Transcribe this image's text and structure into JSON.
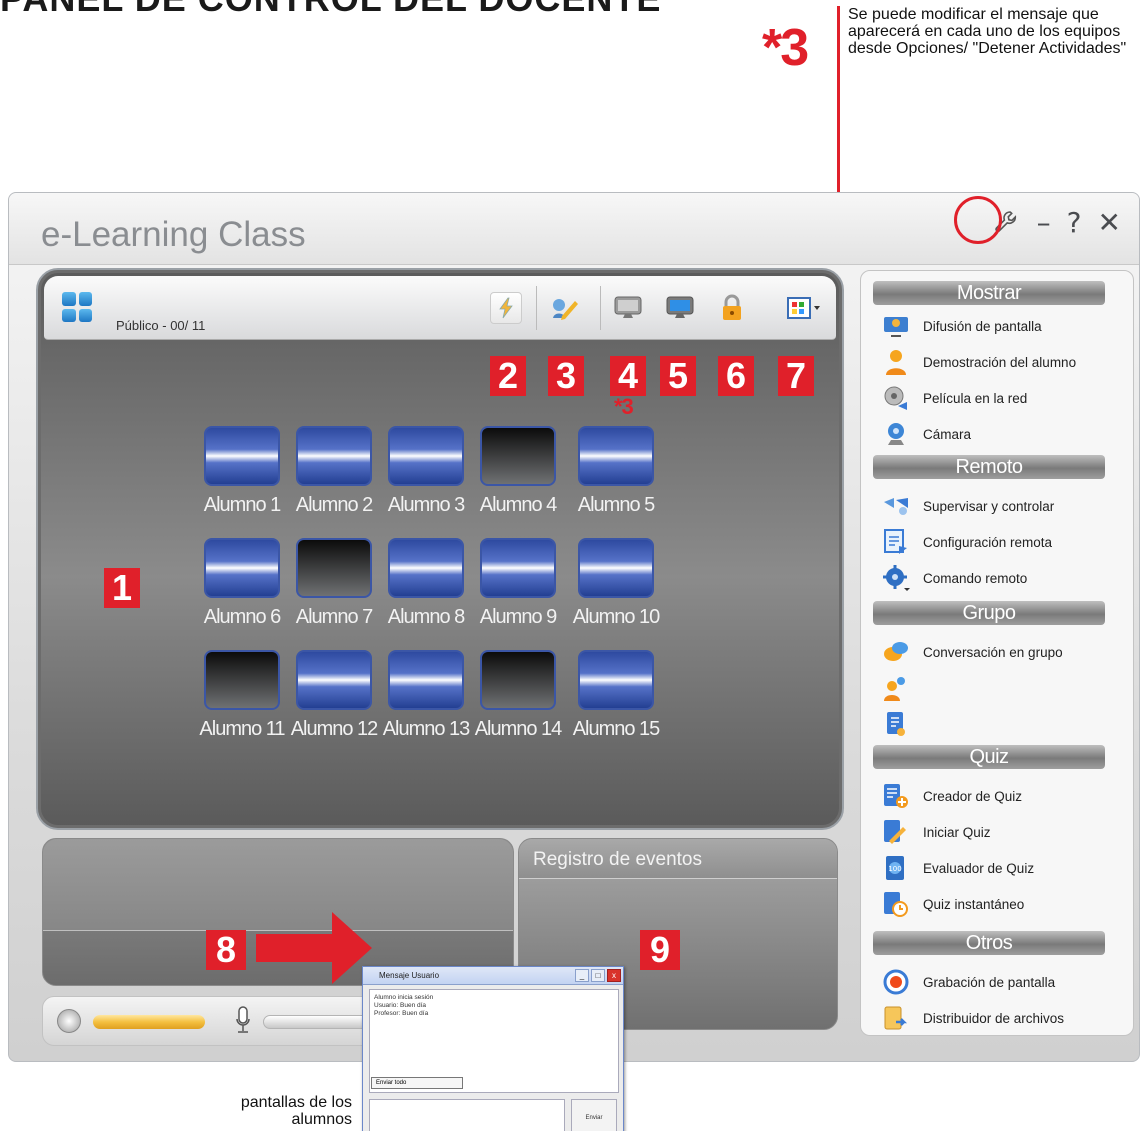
{
  "page": {
    "top_heading": "PANEL DE CONTROL DEL DOCENTE"
  },
  "annotation": {
    "marker": "*3",
    "note": "Se puede modificar el mensaje que aparecerá en cada uno de los equipos desde Opciones/ \"Detener Actividades\"",
    "caption": "pantallas de los alumnos"
  },
  "window": {
    "title": "e-Learning Class",
    "buttons": {
      "options_icon": "wrench-icon",
      "minimize": "–",
      "help": "?",
      "close": "✕"
    }
  },
  "toolbar": {
    "view_label": "Público - 00/ 11",
    "icons": [
      "lightning-icon",
      "broadcast-pencil-icon",
      "monitor-gray-icon",
      "monitor-blue-icon",
      "lock-icon",
      "layout-menu-icon"
    ]
  },
  "callouts": {
    "n1": "1",
    "n2": "2",
    "n3": "3",
    "n4": "4",
    "n5": "5",
    "n6": "6",
    "n7": "7",
    "n8": "8",
    "n9": "9",
    "sub4": "*3"
  },
  "students": [
    {
      "name": "Alumno 1",
      "online": true
    },
    {
      "name": "Alumno 2",
      "online": true
    },
    {
      "name": "Alumno 3",
      "online": true
    },
    {
      "name": "Alumno 4",
      "online": false
    },
    {
      "name": "Alumno 5",
      "online": true
    },
    {
      "name": "Alumno 6",
      "online": true
    },
    {
      "name": "Alumno 7",
      "online": false
    },
    {
      "name": "Alumno 8",
      "online": true
    },
    {
      "name": "Alumno 9",
      "online": true
    },
    {
      "name": "Alumno 10",
      "online": true
    },
    {
      "name": "Alumno 11",
      "online": false
    },
    {
      "name": "Alumno 12",
      "online": true
    },
    {
      "name": "Alumno 13",
      "online": true
    },
    {
      "name": "Alumno 14",
      "online": false
    },
    {
      "name": "Alumno 15",
      "online": true
    }
  ],
  "events": {
    "title": "Registro de eventos"
  },
  "chat": {
    "title": "Mensaje Usuario",
    "log": [
      "Alumno inicia sesión",
      "Usuario: Buen día",
      "Profesor: Buen día"
    ],
    "select": "Enviar todo",
    "send": "Enviar"
  },
  "sidebar": {
    "mostrar": {
      "header": "Mostrar",
      "items": [
        "Difusión de pantalla",
        "Demostración del alumno",
        "Película en la red",
        "Cámara"
      ]
    },
    "remoto": {
      "header": "Remoto",
      "items": [
        "Supervisar y controlar",
        "Configuración remota",
        "Comando remoto"
      ]
    },
    "grupo": {
      "header": "Grupo",
      "items": [
        "Conversación en grupo"
      ]
    },
    "quiz": {
      "header": "Quiz",
      "items": [
        "Creador de Quiz",
        "Iniciar Quiz",
        "Evaluador de Quiz",
        "Quiz instantáneo"
      ]
    },
    "otros": {
      "header": "Otros",
      "items": [
        "Grabación de pantalla",
        "Distribuidor de archivos"
      ]
    }
  },
  "colors": {
    "accent_red": "#e0202a",
    "online_blue": "#3b56a6"
  }
}
